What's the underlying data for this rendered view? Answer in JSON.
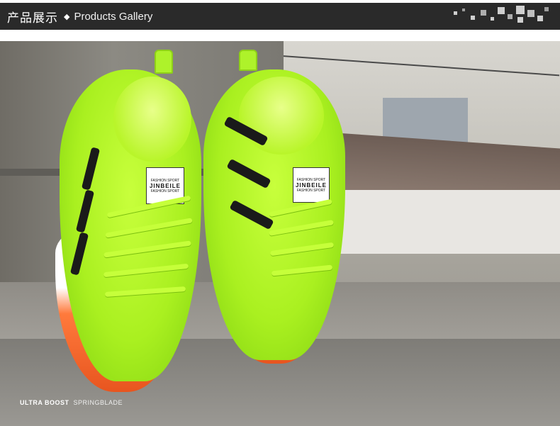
{
  "header": {
    "title_cn": "产品展示",
    "separator_icon": "diamond-icon",
    "title_en": "Products Gallery"
  },
  "photo": {
    "shoe_brand": "JINBEILE",
    "shoe_label_top": "FASHION SPORT",
    "shoe_label_bottom": "FASHION SPORT",
    "caption_bold": "ULTRA BOOST",
    "caption_light": "SPRINGBLADE"
  },
  "colors": {
    "header_bg": "#2a2a2a",
    "shoe_upper": "#aaf020",
    "shoe_sole": "#e8551f",
    "stripe": "#1a1a1a"
  }
}
